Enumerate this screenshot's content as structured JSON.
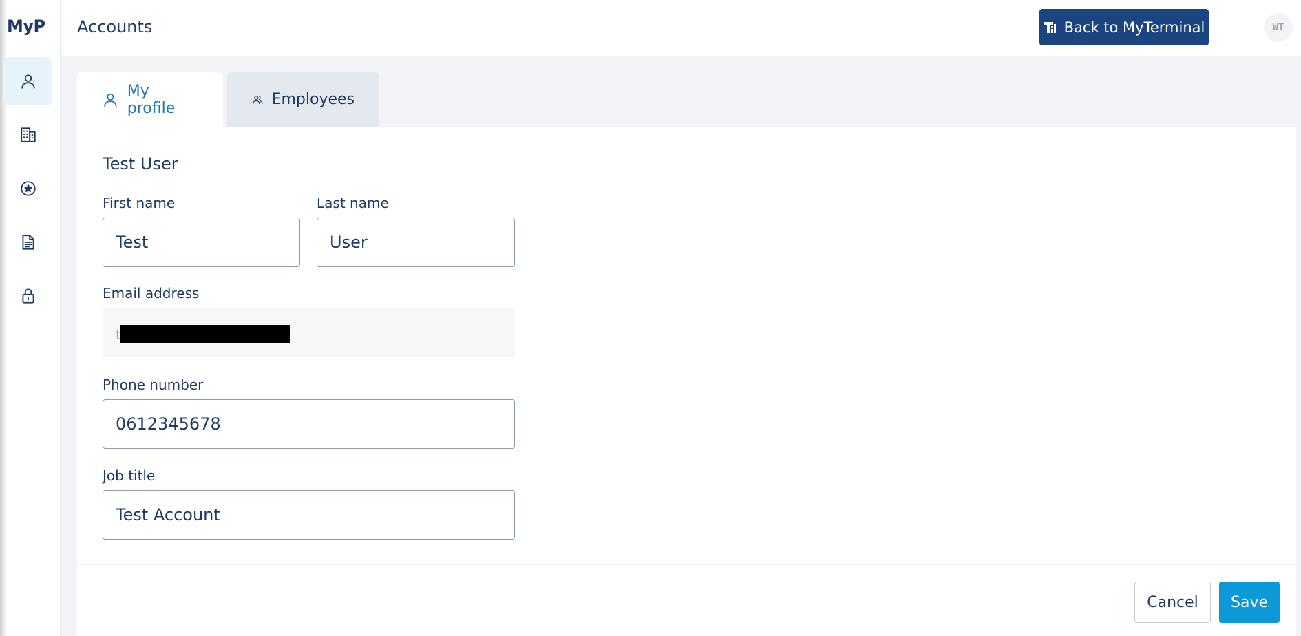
{
  "app": {
    "logo": "MyP",
    "page_title": "Accounts"
  },
  "sidebar": {
    "items": [
      {
        "icon": "user-icon",
        "active": true
      },
      {
        "icon": "building-icon",
        "active": false
      },
      {
        "icon": "star-circle-icon",
        "active": false
      },
      {
        "icon": "document-icon",
        "active": false
      },
      {
        "icon": "lock-icon",
        "active": false
      }
    ]
  },
  "header": {
    "back_button_label": "Back to MyTerminal",
    "avatar_initials": "WT"
  },
  "tabs": [
    {
      "label": "My profile",
      "active": true
    },
    {
      "label": "Employees",
      "active": false
    }
  ],
  "profile": {
    "section_title": "Test User",
    "first_name": {
      "label": "First name",
      "value": "Test"
    },
    "last_name": {
      "label": "Last name",
      "value": "User"
    },
    "email": {
      "label": "Email address",
      "visible_prefix": "t",
      "redacted": true
    },
    "phone": {
      "label": "Phone number",
      "value": "0612345678"
    },
    "job_title": {
      "label": "Job title",
      "value": "Test Account"
    }
  },
  "actions": {
    "cancel_label": "Cancel",
    "save_label": "Save"
  },
  "colors": {
    "primary": "#1b4580",
    "accent": "#0d98d8",
    "text": "#1f3a64",
    "active_tab_text": "#1c79b8"
  }
}
